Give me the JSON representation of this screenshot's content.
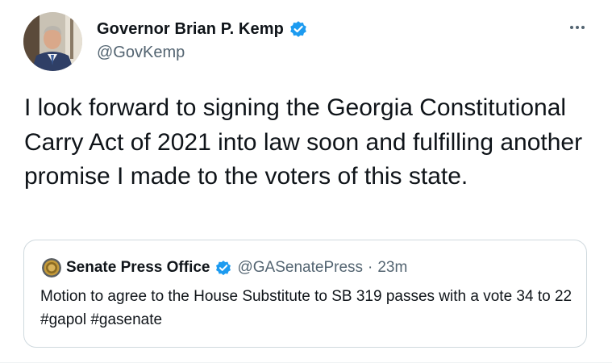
{
  "tweet": {
    "display_name": "Governor Brian P. Kemp",
    "handle": "@GovKemp",
    "verified_icon": "verified-badge-icon",
    "more_icon": "more-horizontal-icon",
    "text": "I look forward to signing the Georgia Constitutional Carry Act of 2021 into law soon and fulfilling another promise I made to the voters of this state."
  },
  "quote": {
    "display_name": "Senate Press Office",
    "handle": "@GASenatePress",
    "separator": "·",
    "time": "23m",
    "text": "Motion to agree to the House Substitute to SB 319 passes with a vote 34 to 22 #gapol #gasenate"
  },
  "colors": {
    "verified_blue": "#1d9bf0",
    "text_primary": "#0f1419",
    "text_secondary": "#536471",
    "border": "#cfd9de"
  }
}
